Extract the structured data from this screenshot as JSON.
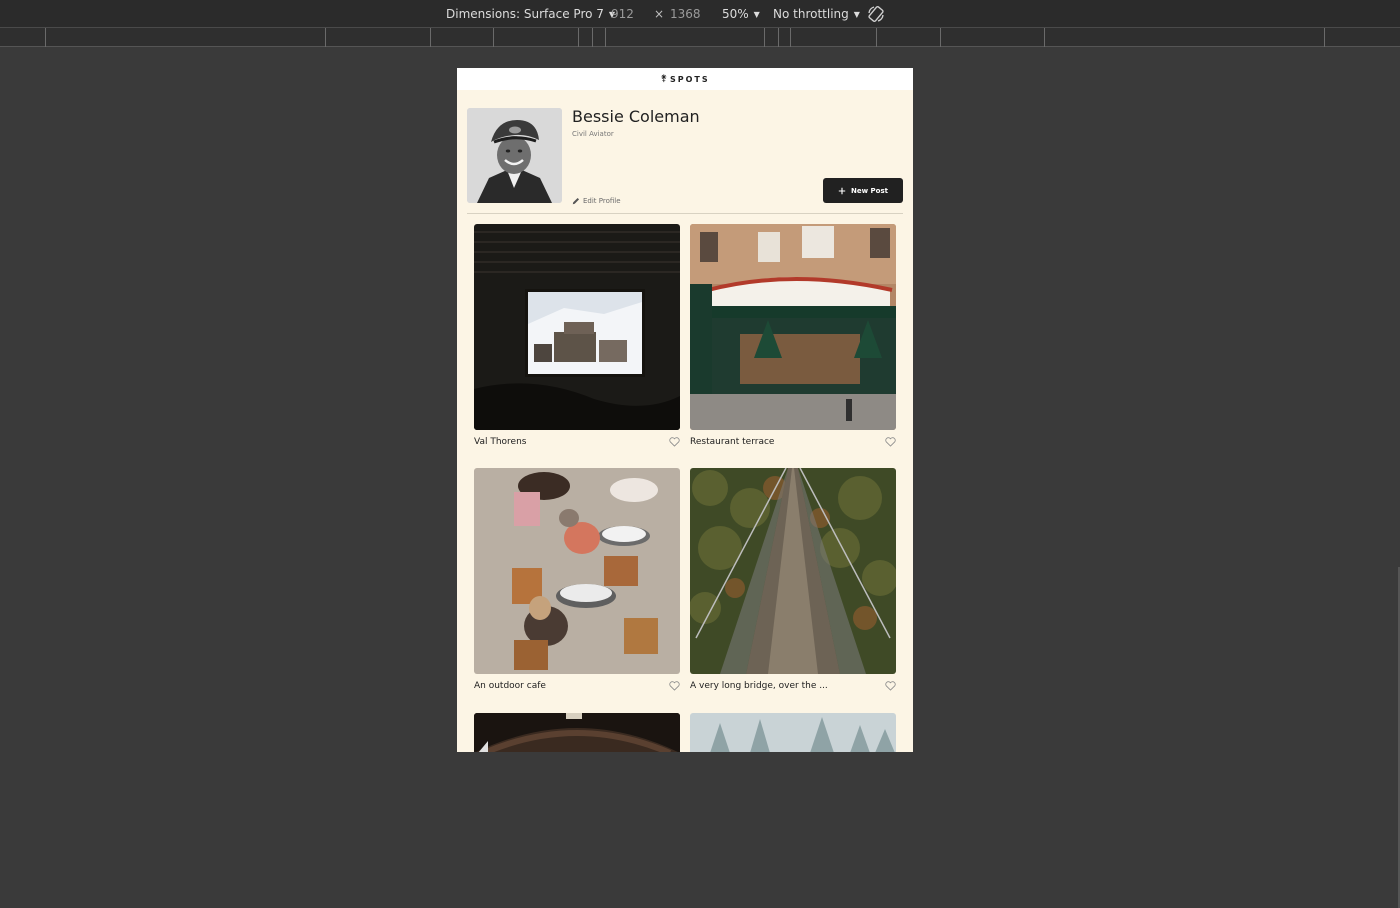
{
  "devtools": {
    "dimensions_label": "Dimensions: Surface Pro 7",
    "width": "912",
    "times": "×",
    "height": "1368",
    "zoom": "50%",
    "throttling": "No throttling",
    "rotate_icon": "rotate-icon"
  },
  "app": {
    "logo_mark": "⚵",
    "logo_text": "SPOTS"
  },
  "profile": {
    "name": "Bessie Coleman",
    "description": "Civil Aviator",
    "edit_label": "Edit Profile",
    "new_post_label": "New Post"
  },
  "cards": [
    {
      "title": "Val Thorens"
    },
    {
      "title": "Restaurant terrace"
    },
    {
      "title": "An outdoor cafe"
    },
    {
      "title": "A very long bridge, over the ..."
    },
    {
      "title": ""
    },
    {
      "title": ""
    }
  ],
  "colors": {
    "page_bg": "#fcf5e5",
    "button_bg": "#212121",
    "devtools_bg": "#2b2b2b",
    "workspace_bg": "#3a3a3a"
  }
}
